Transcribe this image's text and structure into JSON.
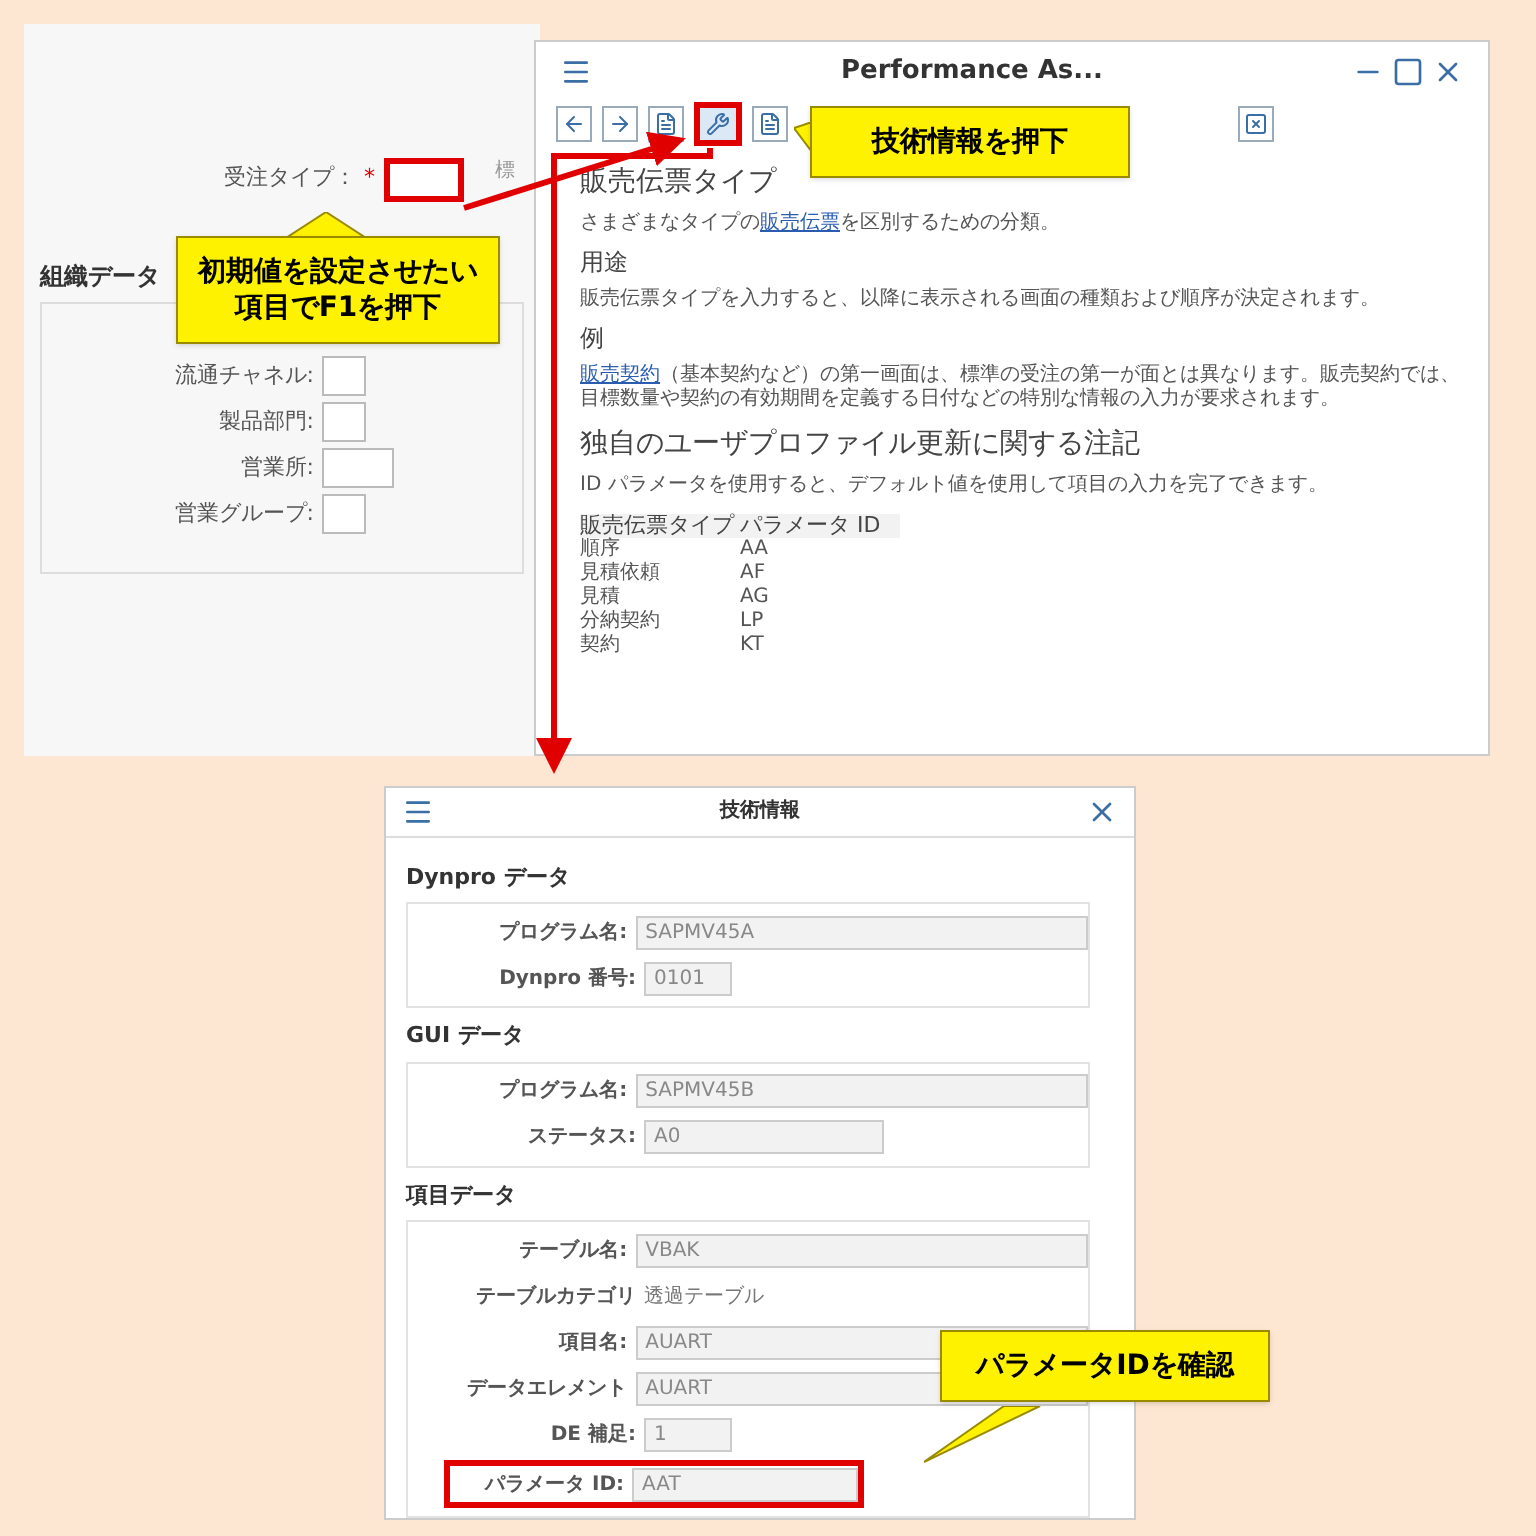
{
  "order_screen": {
    "order_type_label": "受注タイプ：",
    "required_mark": "*",
    "order_type_highlighted": true,
    "cut_text": "標",
    "section_title": "組織データ",
    "fields": [
      {
        "label": "流通チャネル:"
      },
      {
        "label": "製品部門:"
      },
      {
        "label": "営業所:"
      },
      {
        "label": "営業グループ:"
      }
    ]
  },
  "help_window": {
    "title": "Performance As...",
    "toolbar": [
      {
        "kind": "back",
        "highlighted": false
      },
      {
        "kind": "forward",
        "highlighted": false
      },
      {
        "kind": "page",
        "highlighted": false
      },
      {
        "kind": "wrench",
        "highlighted": true
      },
      {
        "kind": "page",
        "highlighted": false
      },
      {
        "kind": "close",
        "highlighted": false
      }
    ],
    "blocks": [
      {
        "kind": "heading",
        "text": "販売伝票タイプ"
      },
      {
        "kind": "paragraph",
        "before": "さまざまなタイプの",
        "link": "販売伝票",
        "after": "を区別するための分類。"
      },
      {
        "kind": "subheading",
        "text": "用途"
      },
      {
        "kind": "paragraph",
        "before": "販売伝票タイプを入力すると、以降に表示される画面の種類および順序が決定されます。"
      },
      {
        "kind": "subheading",
        "text": "例"
      },
      {
        "kind": "paragraph",
        "link": "販売契約",
        "after": "（基本契約など）の第一画面は、標準の受注の第一が面とは異なります。販売契約では、目標数量や契約の有効期間を定義する日付などの特別な情報の入力が要求されます。"
      },
      {
        "kind": "heading",
        "text": "独自のユーザプロファイル更新に関する注記"
      },
      {
        "kind": "paragraph",
        "before": "ID パラメータを使用すると、デフォルト値を使用して項目の入力を完了できます。"
      }
    ],
    "table": {
      "columns": [
        "販売伝票タイプ",
        "パラメータ ID"
      ],
      "rows": [
        [
          "順序",
          "AA"
        ],
        [
          "見積依頼",
          "AF"
        ],
        [
          "見積",
          "AG"
        ],
        [
          "分納契約",
          "LP"
        ],
        [
          "契約",
          "KT"
        ]
      ]
    }
  },
  "tech_window": {
    "title": "技術情報",
    "groups": [
      {
        "title": "Dynpro データ",
        "fields": [
          {
            "kind": "field",
            "label": "プログラム名:",
            "value": "SAPMV45A",
            "highlighted": false
          },
          {
            "kind": "field",
            "label": "Dynpro 番号:",
            "value": "0101",
            "highlighted": false
          }
        ]
      },
      {
        "title": "GUI データ",
        "fields": [
          {
            "kind": "field",
            "label": "プログラム名:",
            "value": "SAPMV45B",
            "highlighted": false
          },
          {
            "kind": "field",
            "label": "ステータス:",
            "value": "A0",
            "highlighted": false
          }
        ]
      },
      {
        "title": "項目データ",
        "fields": [
          {
            "kind": "field",
            "label": "テーブル名:",
            "value": "VBAK",
            "highlighted": false
          },
          {
            "kind": "text",
            "label": "テーブルカテゴリ",
            "value": "透過テーブル",
            "highlighted": false
          },
          {
            "kind": "field",
            "label": "項目名:",
            "value": "AUART",
            "highlighted": false
          },
          {
            "kind": "field",
            "label": "データエレメント",
            "value": "AUART",
            "highlighted": false
          },
          {
            "kind": "field",
            "label": "DE 補足:",
            "value": "1",
            "highlighted": false
          },
          {
            "kind": "field",
            "label": "パラメータ ID:",
            "value": "AAT",
            "highlighted": true
          }
        ]
      }
    ]
  },
  "callouts": [
    {
      "lines": [
        "初期値を設定させたい",
        "項目でF1を押下"
      ]
    },
    {
      "lines": [
        "技術情報を押下"
      ]
    },
    {
      "lines": [
        "パラメータIDを確認"
      ]
    }
  ]
}
